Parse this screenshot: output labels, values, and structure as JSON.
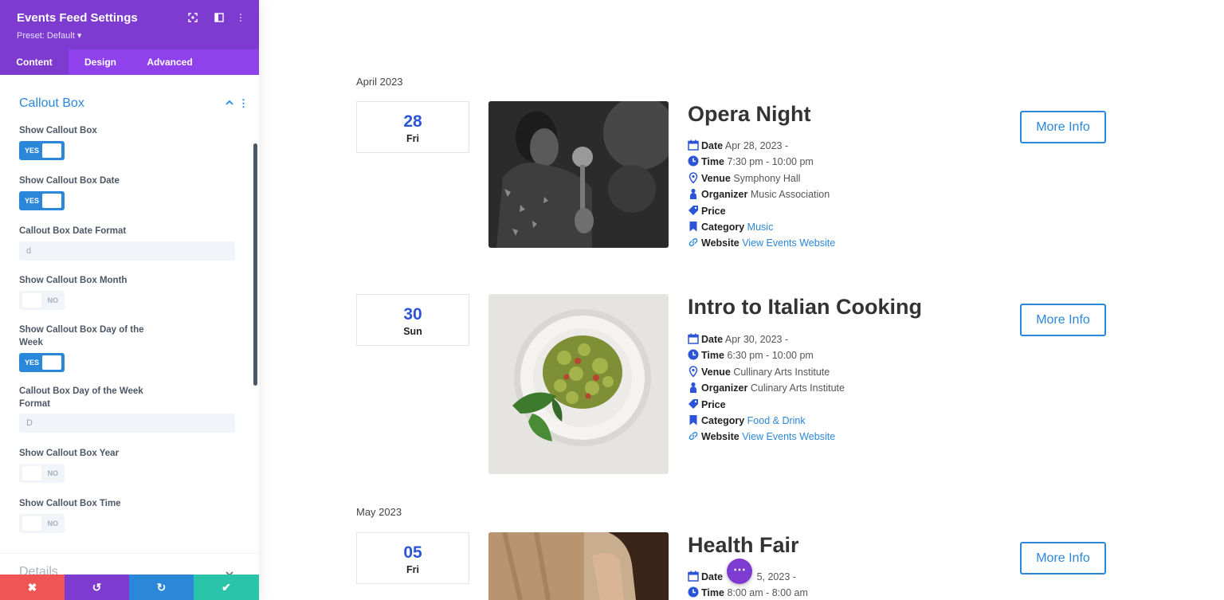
{
  "panel": {
    "title": "Events Feed Settings",
    "preset": "Preset: Default ▾",
    "tabs": [
      "Content",
      "Design",
      "Advanced"
    ],
    "section_title": "Callout Box",
    "settings": [
      {
        "label": "Show Callout Box",
        "type": "toggle",
        "state": "YES"
      },
      {
        "label": "Show Callout Box Date",
        "type": "toggle",
        "state": "YES"
      },
      {
        "label": "Callout Box Date Format",
        "type": "text",
        "value": "d"
      },
      {
        "label": "Show Callout Box Month",
        "type": "toggle",
        "state": "NO"
      },
      {
        "label": "Show Callout Box Day of the Week",
        "type": "toggle",
        "state": "YES"
      },
      {
        "label": "Callout Box Day of the Week Format",
        "type": "text",
        "value": "D"
      },
      {
        "label": "Show Callout Box Year",
        "type": "toggle",
        "state": "NO"
      },
      {
        "label": "Show Callout Box Time",
        "type": "toggle",
        "state": "NO"
      }
    ],
    "next_section_title": "Details",
    "footer": {
      "cancel": "✖",
      "undo": "↺",
      "redo": "↻",
      "save": "✔"
    }
  },
  "feed": {
    "months": [
      "April 2023",
      "May 2023"
    ],
    "more_info_label": "More Info",
    "events": [
      {
        "day": "28",
        "dow": "Fri",
        "title": "Opera Night",
        "date_label": "Date",
        "date": "Apr 28, 2023 -",
        "time_label": "Time",
        "time": "7:30 pm - 10:00 pm",
        "venue_label": "Venue",
        "venue": "Symphony Hall",
        "organizer_label": "Organizer",
        "organizer": "Music Association",
        "price_label": "Price",
        "category_label": "Category",
        "category": "Music",
        "website_label": "Website",
        "website": "View Events Website"
      },
      {
        "day": "30",
        "dow": "Sun",
        "title": "Intro to Italian Cooking",
        "date_label": "Date",
        "date": "Apr 30, 2023 -",
        "time_label": "Time",
        "time": "6:30 pm - 10:00 pm",
        "venue_label": "Venue",
        "venue": "Cullinary Arts Institute",
        "organizer_label": "Organizer",
        "organizer": "Culinary Arts Institute",
        "price_label": "Price",
        "category_label": "Category",
        "category": "Food & Drink",
        "website_label": "Website",
        "website": "View Events Website"
      },
      {
        "day": "05",
        "dow": "Fri",
        "title": "Health Fair",
        "date_label": "Date",
        "date": "5, 2023 -",
        "time_label": "Time",
        "time": "8:00 am - 8:00 am"
      }
    ]
  },
  "colors": {
    "purple": "#7e3bd0",
    "purple_light": "#8f42ec",
    "accent_blue": "#2b87da",
    "date_blue": "#2b55d6",
    "red": "#ef5555",
    "green": "#29c4a9"
  },
  "icons": [
    "fullscreen-icon",
    "sidebar-icon",
    "more-vertical-icon",
    "chevron-up-icon",
    "chevron-down-icon",
    "calendar-icon",
    "clock-icon",
    "map-pin-icon",
    "user-icon",
    "tag-icon",
    "bookmark-icon",
    "link-icon",
    "ellipsis-icon"
  ]
}
